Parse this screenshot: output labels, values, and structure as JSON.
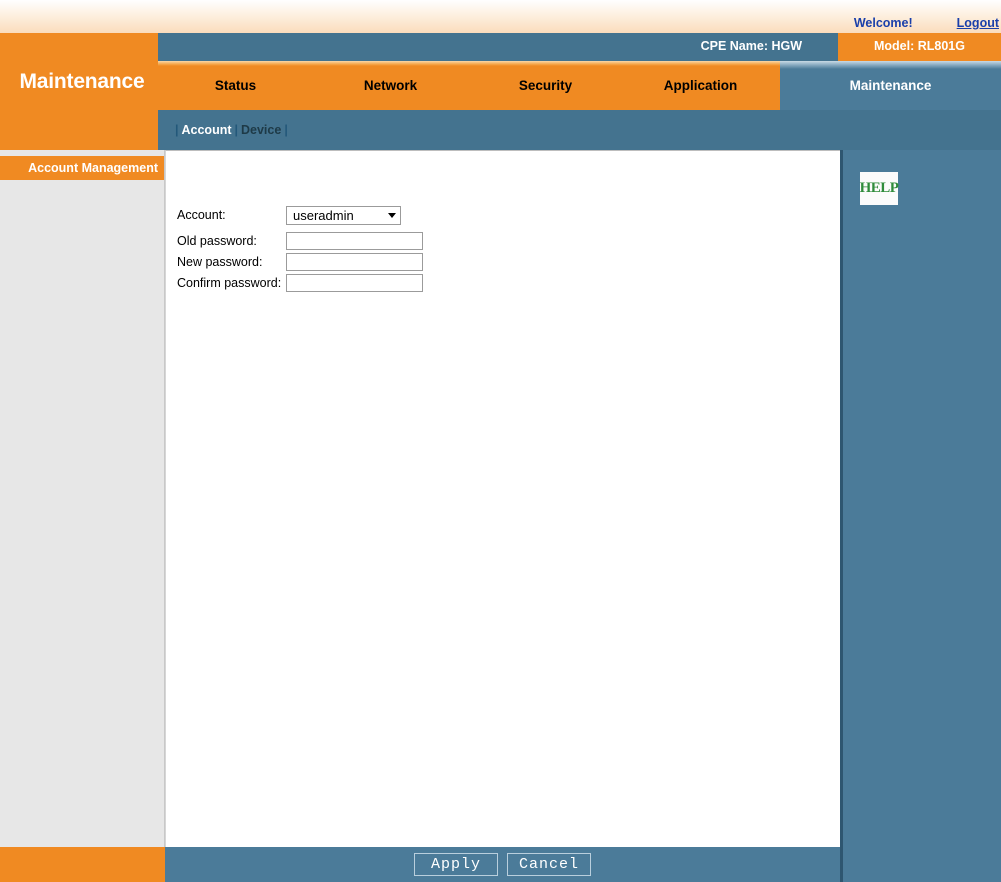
{
  "topbar": {
    "welcome": "Welcome!",
    "logout": "Logout"
  },
  "header": {
    "cpe_name": "CPE Name: HGW",
    "model": "Model: RL801G",
    "page_title": "Maintenance"
  },
  "nav": {
    "items": [
      {
        "label": "Status"
      },
      {
        "label": "Network"
      },
      {
        "label": "Security"
      },
      {
        "label": "Application"
      }
    ],
    "active": {
      "label": "Maintenance"
    }
  },
  "subnav": {
    "sep": "|",
    "items": [
      {
        "label": "Account",
        "state": "active"
      },
      {
        "label": "Device",
        "state": "inactive"
      }
    ]
  },
  "sidebar": {
    "items": [
      {
        "label": "Account Management"
      }
    ]
  },
  "form": {
    "account": {
      "label": "Account:",
      "value": "useradmin",
      "options": [
        "useradmin"
      ]
    },
    "old_password": {
      "label": "Old password:",
      "value": "",
      "placeholder": ""
    },
    "new_password": {
      "label": "New password:",
      "value": "",
      "placeholder": ""
    },
    "confirm_password": {
      "label": "Confirm password:",
      "value": "",
      "placeholder": ""
    }
  },
  "help": {
    "label": "HELP"
  },
  "footer": {
    "apply": "Apply",
    "cancel": "Cancel"
  },
  "colors": {
    "orange": "#f08a22",
    "blue_dark": "#44738f",
    "blue_panel": "#4b7b99",
    "sidebar_gray": "#e7e7e7",
    "link_blue": "#1a3faa",
    "help_green": "#2f8c3b"
  }
}
